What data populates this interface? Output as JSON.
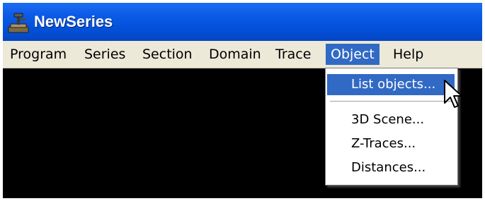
{
  "window": {
    "title": "NewSeries",
    "app_icon": "newseries-app-icon"
  },
  "menubar": {
    "items": [
      {
        "label": "Program"
      },
      {
        "label": "Series"
      },
      {
        "label": "Section"
      },
      {
        "label": "Domain"
      },
      {
        "label": "Trace"
      },
      {
        "label": "Object",
        "open": true
      },
      {
        "label": "Help"
      }
    ]
  },
  "object_menu": {
    "items": [
      {
        "label": "List objects...",
        "highlighted": true
      },
      {
        "label": "3D Scene..."
      },
      {
        "label": "Z-Traces..."
      },
      {
        "label": "Distances..."
      }
    ]
  },
  "colors": {
    "title_bar": "#0350d8",
    "menu_bar": "#ece9d8",
    "selection": "#316ac5",
    "canvas": "#000000"
  },
  "cursor": "arrow-cursor-icon"
}
